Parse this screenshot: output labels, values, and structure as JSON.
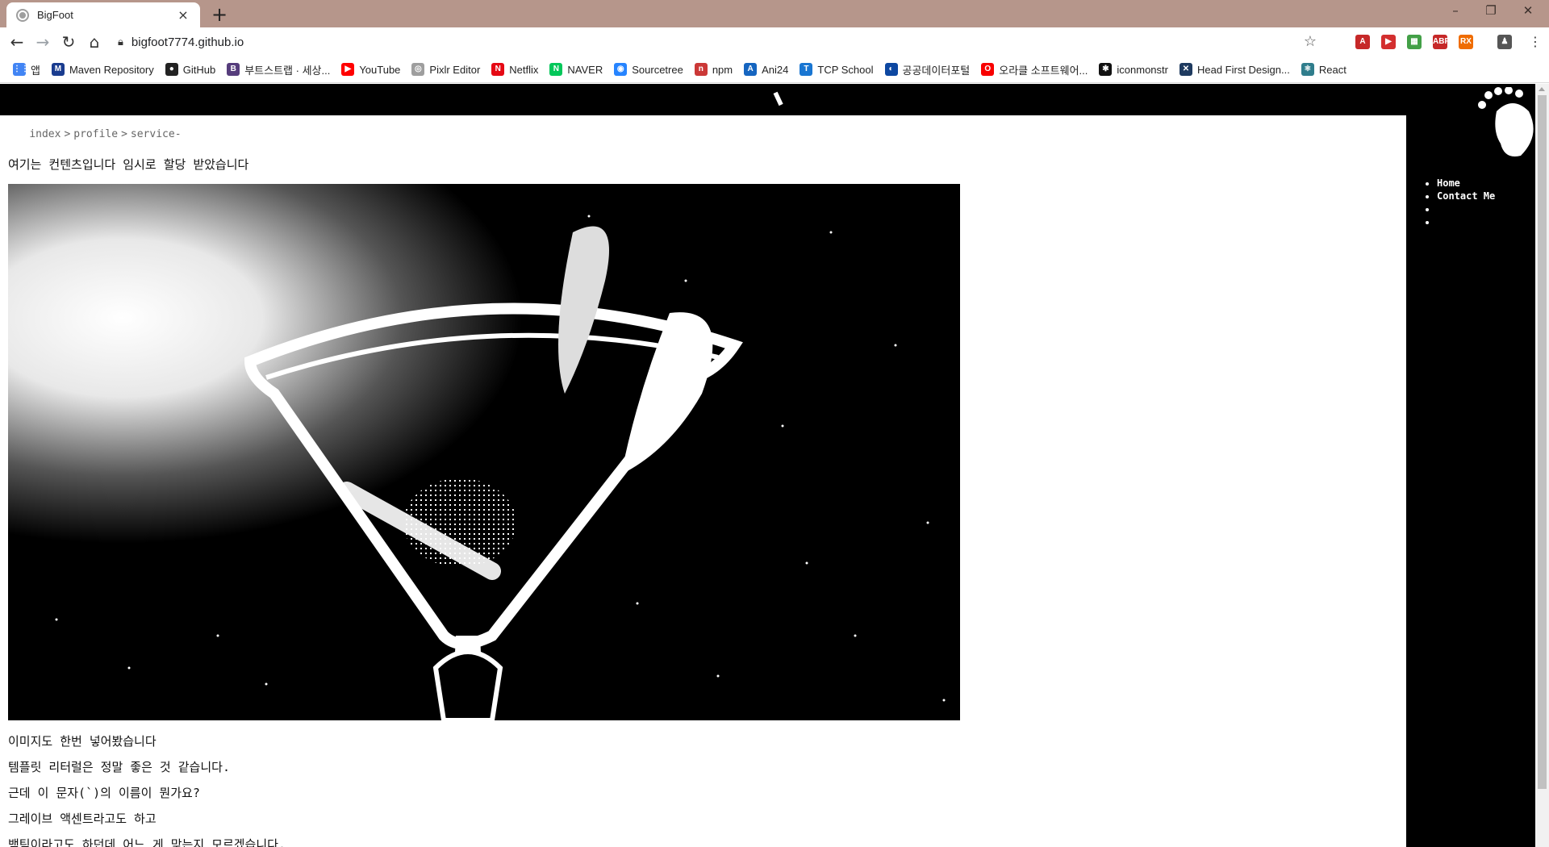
{
  "browser": {
    "tab_title": "BigFoot",
    "tab_close_glyph": "×",
    "new_tab_glyph": "+",
    "url": "bigfoot7774.github.io",
    "window_controls": [
      "–",
      "❐",
      "✕"
    ],
    "accent": "#b6968b"
  },
  "toolbar": {
    "back_glyph": "←",
    "forward_glyph": "→",
    "reload_glyph": "↻",
    "home_glyph": "⌂",
    "star_glyph": "☆"
  },
  "extensions": [
    {
      "label": "A",
      "color": "#c62828"
    },
    {
      "label": "▶",
      "color": "#d32f2f"
    },
    {
      "label": "▦",
      "color": "#43a047"
    },
    {
      "label": "ABP",
      "color": "#c62828"
    },
    {
      "label": "RX",
      "color": "#ef6c00"
    },
    {
      "label": "♟",
      "color": "#555555"
    }
  ],
  "bookmarks": [
    {
      "label": "앱",
      "icon": "apps-icon",
      "color": "#4285f4",
      "glyph": "⋮⋮"
    },
    {
      "label": "Maven Repository",
      "icon": "maven-icon",
      "color": "#1a3c8f",
      "glyph": "M"
    },
    {
      "label": "GitHub",
      "icon": "github-icon",
      "color": "#222222",
      "glyph": "●"
    },
    {
      "label": "부트스트랩 · 세상...",
      "icon": "bootstrap-icon",
      "color": "#563d7c",
      "glyph": "B"
    },
    {
      "label": "YouTube",
      "icon": "youtube-icon",
      "color": "#ff0000",
      "glyph": "▶"
    },
    {
      "label": "Pixlr Editor",
      "icon": "pixlr-icon",
      "color": "#9e9e9e",
      "glyph": "◎"
    },
    {
      "label": "Netflix",
      "icon": "netflix-icon",
      "color": "#e50914",
      "glyph": "N"
    },
    {
      "label": "NAVER",
      "icon": "naver-icon",
      "color": "#03c75a",
      "glyph": "N"
    },
    {
      "label": "Sourcetree",
      "icon": "sourcetree-icon",
      "color": "#2684ff",
      "glyph": "◉"
    },
    {
      "label": "npm",
      "icon": "npm-icon",
      "color": "#cb3837",
      "glyph": "n"
    },
    {
      "label": "Ani24",
      "icon": "ani24-icon",
      "color": "#1565c0",
      "glyph": "A"
    },
    {
      "label": "TCP School",
      "icon": "tcpschool-icon",
      "color": "#1976d2",
      "glyph": "T"
    },
    {
      "label": "공공데이터포털",
      "icon": "datagokr-icon",
      "color": "#0d47a1",
      "glyph": "◐"
    },
    {
      "label": "오라클 소프트웨어...",
      "icon": "oracle-icon",
      "color": "#f80000",
      "glyph": "O"
    },
    {
      "label": "iconmonstr",
      "icon": "iconmonstr-icon",
      "color": "#111111",
      "glyph": "✱"
    },
    {
      "label": "Head First Design...",
      "icon": "headfirst-icon",
      "color": "#1e3a5f",
      "glyph": "✕"
    },
    {
      "label": "React",
      "icon": "react-icon",
      "color": "#2f7d8c",
      "glyph": "⚛"
    }
  ],
  "page": {
    "breadcrumb": [
      "index",
      "profile",
      "service-"
    ],
    "breadcrumb_sep": ">",
    "intro": "여기는 컨텐츠입니다 임시로 할당 받았습니다",
    "paragraphs": [
      "이미지도 한번 넣어봤습니다",
      "템플릿 리터럴은 정말 좋은 것 같습니다.",
      "근데 이 문자(`)의 이름이 뭔가요?",
      "그레이브 액센트라고도 하고",
      "백틱이라고도 하던데 어느 게 맞는지 모르겠습니다."
    ],
    "nav": [
      "Home",
      "Contact Me",
      "",
      ""
    ]
  }
}
